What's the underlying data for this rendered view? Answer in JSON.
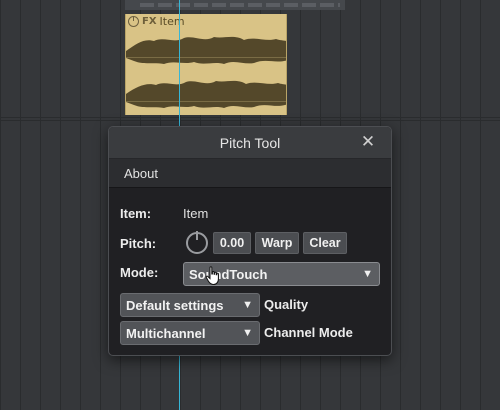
{
  "arrange": {
    "item_fx_label": "FX",
    "item_name": "Item",
    "colors": {
      "item": "#d9c386",
      "waveform": "#54482a",
      "cursor": "#36b6d6"
    }
  },
  "dialog": {
    "title": "Pitch Tool",
    "close_icon": "close-icon",
    "menu": [
      "About"
    ],
    "item": {
      "label": "Item:",
      "value": "Item"
    },
    "pitch": {
      "label": "Pitch:",
      "value": "0.00",
      "warp": "Warp",
      "clear": "Clear"
    },
    "mode": {
      "label": "Mode:",
      "selected": "SoundTouch"
    },
    "quality": {
      "selected": "Default settings",
      "label": "Quality"
    },
    "channel": {
      "selected": "Multichannel",
      "label": "Channel Mode"
    }
  }
}
